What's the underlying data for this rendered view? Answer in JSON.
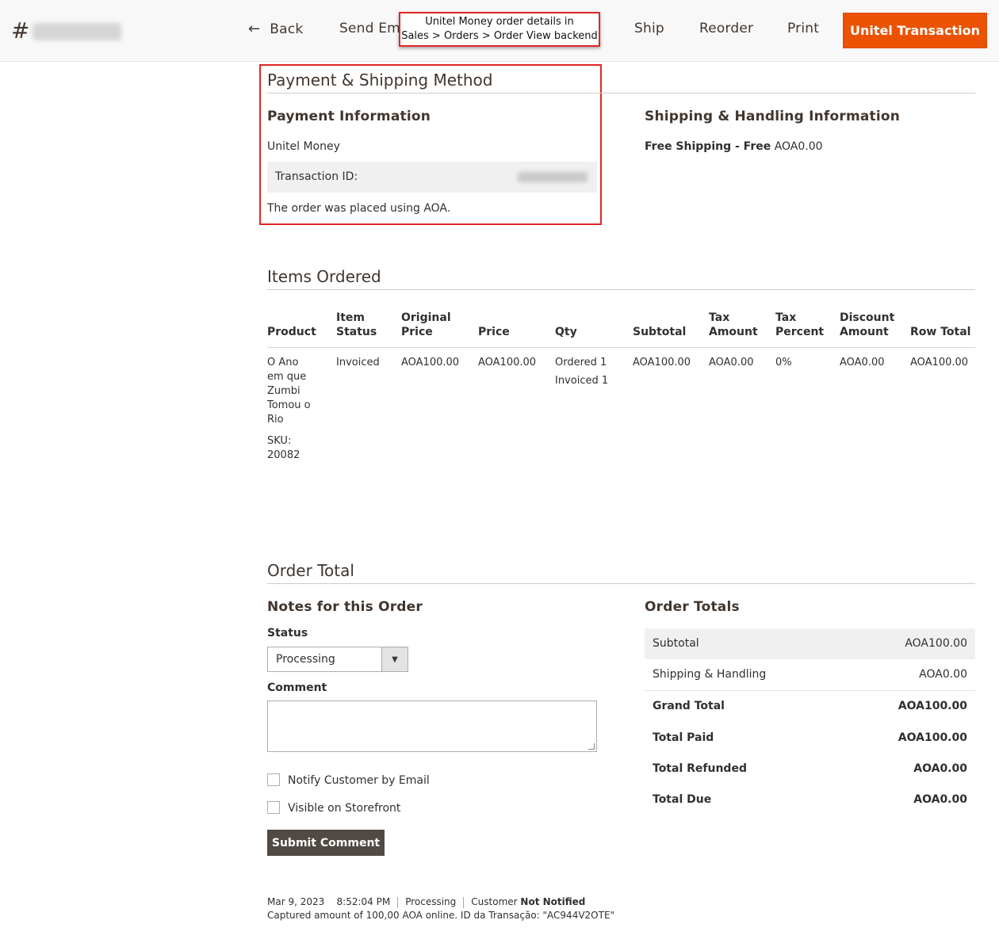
{
  "header": {
    "order_prefix": "#",
    "back_label": "Back",
    "send_email_label": "Send Ema",
    "ship_label": "Ship",
    "reorder_label": "Reorder",
    "print_label": "Print",
    "primary_label": "Unitel Transaction"
  },
  "annotation": {
    "line1": "Unitel Money order details in",
    "line2": "Sales > Orders > Order View backend"
  },
  "payment_shipping": {
    "section_title": "Payment & Shipping Method",
    "payment_title": "Payment Information",
    "payment_method": "Unitel Money",
    "transaction_label": "Transaction ID:",
    "placed_note": "The order was placed using AOA.",
    "shipping_title": "Shipping & Handling Information",
    "shipping_method": "Free Shipping - Free",
    "shipping_amount": "AOA0.00"
  },
  "items": {
    "section_title": "Items Ordered",
    "headers": {
      "product": "Product",
      "item_status_1": "Item",
      "item_status_2": "Status",
      "original_price_1": "Original",
      "original_price_2": "Price",
      "price": "Price",
      "qty": "Qty",
      "subtotal": "Subtotal",
      "tax_amount_1": "Tax",
      "tax_amount_2": "Amount",
      "tax_percent_1": "Tax",
      "tax_percent_2": "Percent",
      "discount_1": "Discount",
      "discount_2": "Amount",
      "row_total": "Row Total"
    },
    "rows": [
      {
        "product_lines": [
          "O Ano",
          "em que",
          "Zumbi",
          "Tomou o",
          "Rio"
        ],
        "sku_label": "SKU:",
        "sku": "20082",
        "status": "Invoiced",
        "original_price": "AOA100.00",
        "price": "AOA100.00",
        "qty_ordered": "Ordered 1",
        "qty_invoiced": "Invoiced 1",
        "subtotal": "AOA100.00",
        "tax_amount": "AOA0.00",
        "tax_percent": "0%",
        "discount": "AOA0.00",
        "row_total": "AOA100.00"
      }
    ]
  },
  "order_total": {
    "section_title": "Order Total",
    "notes_title": "Notes for this Order",
    "status_label": "Status",
    "status_value": "Processing",
    "comment_label": "Comment",
    "notify_label": "Notify Customer by Email",
    "visible_label": "Visible on Storefront",
    "submit_label": "Submit Comment",
    "totals_title": "Order Totals",
    "totals": [
      {
        "label": "Subtotal",
        "value": "AOA100.00"
      },
      {
        "label": "Shipping & Handling",
        "value": "AOA0.00"
      },
      {
        "label": "Grand Total",
        "value": "AOA100.00"
      },
      {
        "label": "Total Paid",
        "value": "AOA100.00"
      },
      {
        "label": "Total Refunded",
        "value": "AOA0.00"
      },
      {
        "label": "Total Due",
        "value": "AOA0.00"
      }
    ]
  },
  "history": {
    "date": "Mar 9, 2023",
    "time": "8:52:04 PM",
    "status": "Processing",
    "customer_prefix": "Customer",
    "customer_state": "Not Notified",
    "message": "Captured amount of 100,00 AOA online. ID da Transação: \"AC944V2OTE\""
  },
  "colors": {
    "accent": "#eb5202",
    "annotation_border": "#e22626",
    "submit_bg": "#514943"
  }
}
